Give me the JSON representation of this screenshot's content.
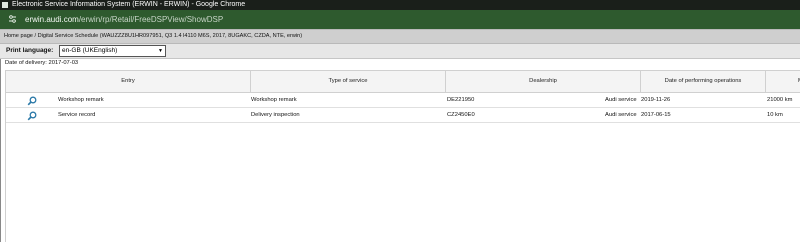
{
  "window": {
    "title": "Electronic Service Information System (ERWIN - ERWIN) - Google Chrome"
  },
  "address": {
    "url_domain": "erwin.audi.com",
    "url_path": "/erwin/rp/Retail/FreeDSPView/ShowDSP"
  },
  "breadcrumb": {
    "text": "Home page / Digital Service Schedule (WAUZZZ8U1HR097951, Q3 1.4 l4110 M6S, 2017, 8UGAKC, CZDA, NTE, erwin)"
  },
  "print_language": {
    "label": "Print language:",
    "selected": "en-GB (UKEnglish)"
  },
  "delivery": {
    "text": "Date of delivery: 2017-07-03"
  },
  "table": {
    "columns": [
      "Entry",
      "Type of service",
      "Dealership",
      "Date of performing operations",
      "M"
    ],
    "rows": [
      {
        "entry": "Workshop remark",
        "type": "Workshop remark",
        "dealer_code": "DE221950",
        "dealer_name": "Audi service",
        "date": "2019-11-26",
        "mileage": "21000 km"
      },
      {
        "entry": "Service record",
        "type": "Delivery inspection",
        "dealer_code": "CZ2450E0",
        "dealer_name": "Audi service",
        "date": "2017-06-15",
        "mileage": "10 km"
      }
    ]
  },
  "colors": {
    "titlebar": "#1a1f1a",
    "addressbar": "#2e5a2e",
    "header_bg": "#cfcfcf",
    "table_header": "#f4f4f4",
    "icon": "#2b79a8"
  },
  "icons": [
    "site-settings-icon",
    "magnifier-icon",
    "chevron-down-icon"
  ]
}
